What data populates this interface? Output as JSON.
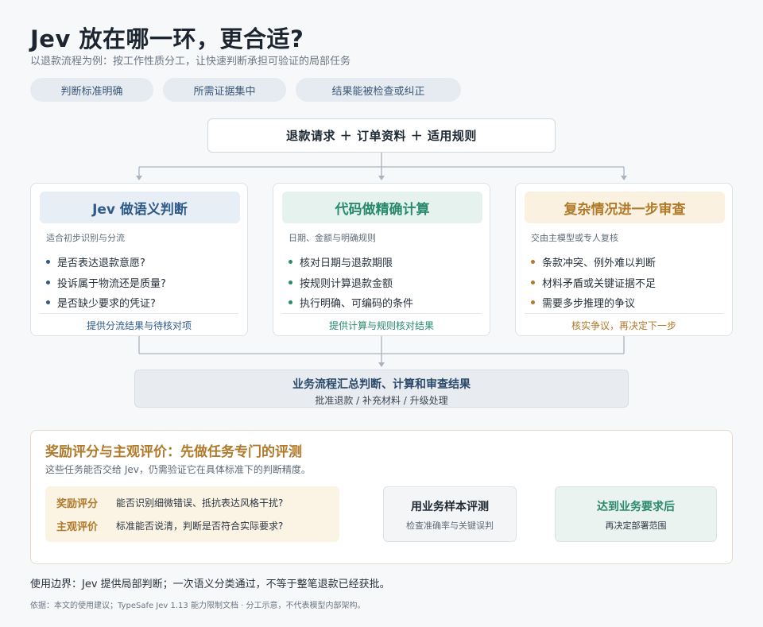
{
  "title": "Jev 放在哪一环，更合适?",
  "subtitle": "以退款流程为例：按工作性质分工，让快速判断承担可验证的局部任务",
  "pills": [
    "判断标准明确",
    "所需证据集中",
    "结果能被检查或纠正"
  ],
  "input": "退款请求 ＋ 订单资料 ＋ 适用规则",
  "cards": [
    {
      "title": "Jev 做语义判断",
      "desc": "适合初步识别与分流",
      "items": [
        "是否表达退款意愿?",
        "投诉属于物流还是质量?",
        "是否缺少要求的凭证?"
      ],
      "footer": "提供分流结果与待核对项",
      "accent": "#2f5b8a",
      "head_bg": "#e8eef5"
    },
    {
      "title": "代码做精确计算",
      "desc": "日期、金额与明确规则",
      "items": [
        "核对日期与退款期限",
        "按规则计算退款金额",
        "执行明确、可编码的条件"
      ],
      "footer": "提供计算与规则核对结果",
      "accent": "#2a8a6e",
      "head_bg": "#e5f2ed"
    },
    {
      "title": "复杂情况进一步审查",
      "desc": "交由主模型或专人复核",
      "items": [
        "条款冲突、例外难以判断",
        "材料矛盾或关键证据不足",
        "需要多步推理的争议"
      ],
      "footer": "核实争议，再决定下一步",
      "accent": "#b07a2a",
      "head_bg": "#fbf1e1"
    }
  ],
  "summary": {
    "title": "业务流程汇总判断、计算和审查结果",
    "sub": "批准退款 / 补充材料 / 升级处理"
  },
  "evaluation": {
    "title": "奖励评分与主观评价：先做任务专门的评测",
    "sub": "这些任务能否交给 Jev，仍需验证它在具体标准下的判断精度。",
    "criteria": [
      {
        "label": "奖励评分",
        "text": "能否识别细微错误、抵抗表达风格干扰?"
      },
      {
        "label": "主观评价",
        "text": "标准能否说清，判断是否符合实际要求?"
      }
    ],
    "step2": {
      "title": "用业务样本评测",
      "sub": "检查准确率与关键误判"
    },
    "step3": {
      "title": "达到业务要求后",
      "sub": "再决定部署范围"
    }
  },
  "boundary": "使用边界：Jev 提供局部判断；一次语义分类通过，不等于整笔退款已经获批。",
  "source": "依据：本文的使用建议；TypeSafe Jev 1.13 能力限制文档 · 分工示意，不代表模型内部架构。",
  "colors": {
    "connector": "#a9b3bd",
    "gold": "#b07a2a",
    "teal": "#2a8a6e",
    "blue": "#2f5b8a"
  }
}
